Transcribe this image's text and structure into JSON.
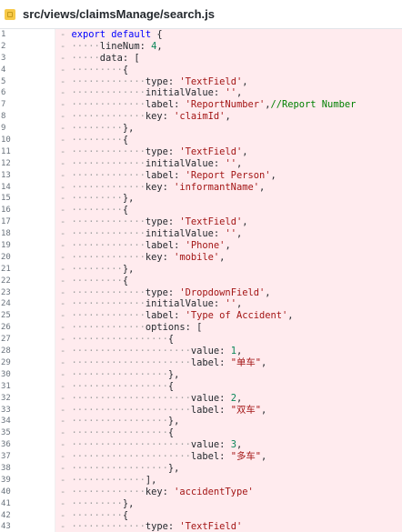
{
  "header": {
    "file_path": "src/views/claimsManage/search.js"
  },
  "code": {
    "lines": [
      [
        [
          "ws",
          "- "
        ],
        [
          "kw",
          "export default"
        ],
        [
          "txt",
          " {"
        ]
      ],
      [
        [
          "ws",
          "- ·····"
        ],
        [
          "txt",
          "lineNum: "
        ],
        [
          "num",
          "4"
        ],
        [
          "txt",
          ","
        ]
      ],
      [
        [
          "ws",
          "- ·····"
        ],
        [
          "txt",
          "data: ["
        ]
      ],
      [
        [
          "ws",
          "- ·········"
        ],
        [
          "txt",
          "{"
        ]
      ],
      [
        [
          "ws",
          "- ·············"
        ],
        [
          "txt",
          "type: "
        ],
        [
          "str",
          "'TextField'"
        ],
        [
          "txt",
          ","
        ]
      ],
      [
        [
          "ws",
          "- ·············"
        ],
        [
          "txt",
          "initialValue: "
        ],
        [
          "str",
          "''"
        ],
        [
          "txt",
          ","
        ]
      ],
      [
        [
          "ws",
          "- ·············"
        ],
        [
          "txt",
          "label: "
        ],
        [
          "str",
          "'ReportNumber'"
        ],
        [
          "txt",
          ","
        ],
        [
          "cmt",
          "//Report Number"
        ]
      ],
      [
        [
          "ws",
          "- ·············"
        ],
        [
          "txt",
          "key: "
        ],
        [
          "str",
          "'claimId'"
        ],
        [
          "txt",
          ","
        ]
      ],
      [
        [
          "ws",
          "- ·········"
        ],
        [
          "txt",
          "},"
        ]
      ],
      [
        [
          "ws",
          "- ·········"
        ],
        [
          "txt",
          "{"
        ]
      ],
      [
        [
          "ws",
          "- ·············"
        ],
        [
          "txt",
          "type: "
        ],
        [
          "str",
          "'TextField'"
        ],
        [
          "txt",
          ","
        ]
      ],
      [
        [
          "ws",
          "- ·············"
        ],
        [
          "txt",
          "initialValue: "
        ],
        [
          "str",
          "''"
        ],
        [
          "txt",
          ","
        ]
      ],
      [
        [
          "ws",
          "- ·············"
        ],
        [
          "txt",
          "label: "
        ],
        [
          "str",
          "'Report Person'"
        ],
        [
          "txt",
          ","
        ]
      ],
      [
        [
          "ws",
          "- ·············"
        ],
        [
          "txt",
          "key: "
        ],
        [
          "str",
          "'informantName'"
        ],
        [
          "txt",
          ","
        ]
      ],
      [
        [
          "ws",
          "- ·········"
        ],
        [
          "txt",
          "},"
        ]
      ],
      [
        [
          "ws",
          "- ·········"
        ],
        [
          "txt",
          "{"
        ]
      ],
      [
        [
          "ws",
          "- ·············"
        ],
        [
          "txt",
          "type: "
        ],
        [
          "str",
          "'TextField'"
        ],
        [
          "txt",
          ","
        ]
      ],
      [
        [
          "ws",
          "- ·············"
        ],
        [
          "txt",
          "initialValue: "
        ],
        [
          "str",
          "''"
        ],
        [
          "txt",
          ","
        ]
      ],
      [
        [
          "ws",
          "- ·············"
        ],
        [
          "txt",
          "label: "
        ],
        [
          "str",
          "'Phone'"
        ],
        [
          "txt",
          ","
        ]
      ],
      [
        [
          "ws",
          "- ·············"
        ],
        [
          "txt",
          "key: "
        ],
        [
          "str",
          "'mobile'"
        ],
        [
          "txt",
          ","
        ]
      ],
      [
        [
          "ws",
          "- ·········"
        ],
        [
          "txt",
          "},"
        ]
      ],
      [
        [
          "ws",
          "- ·········"
        ],
        [
          "txt",
          "{"
        ]
      ],
      [
        [
          "ws",
          "- ·············"
        ],
        [
          "txt",
          "type: "
        ],
        [
          "str",
          "'DropdownField'"
        ],
        [
          "txt",
          ","
        ]
      ],
      [
        [
          "ws",
          "- ·············"
        ],
        [
          "txt",
          "initialValue: "
        ],
        [
          "str",
          "''"
        ],
        [
          "txt",
          ","
        ]
      ],
      [
        [
          "ws",
          "- ·············"
        ],
        [
          "txt",
          "label: "
        ],
        [
          "str",
          "'Type of Accident'"
        ],
        [
          "txt",
          ","
        ]
      ],
      [
        [
          "ws",
          "- ·············"
        ],
        [
          "txt",
          "options: ["
        ]
      ],
      [
        [
          "ws",
          "- ·················"
        ],
        [
          "txt",
          "{"
        ]
      ],
      [
        [
          "ws",
          "- ·····················"
        ],
        [
          "txt",
          "value: "
        ],
        [
          "num",
          "1"
        ],
        [
          "txt",
          ","
        ]
      ],
      [
        [
          "ws",
          "- ·····················"
        ],
        [
          "txt",
          "label: "
        ],
        [
          "str",
          "\"单车\""
        ],
        [
          "txt",
          ","
        ]
      ],
      [
        [
          "ws",
          "- ·················"
        ],
        [
          "txt",
          "},"
        ]
      ],
      [
        [
          "ws",
          "- ·················"
        ],
        [
          "txt",
          "{"
        ]
      ],
      [
        [
          "ws",
          "- ·····················"
        ],
        [
          "txt",
          "value: "
        ],
        [
          "num",
          "2"
        ],
        [
          "txt",
          ","
        ]
      ],
      [
        [
          "ws",
          "- ·····················"
        ],
        [
          "txt",
          "label: "
        ],
        [
          "str",
          "\"双车\""
        ],
        [
          "txt",
          ","
        ]
      ],
      [
        [
          "ws",
          "- ·················"
        ],
        [
          "txt",
          "},"
        ]
      ],
      [
        [
          "ws",
          "- ·················"
        ],
        [
          "txt",
          "{"
        ]
      ],
      [
        [
          "ws",
          "- ·····················"
        ],
        [
          "txt",
          "value: "
        ],
        [
          "num",
          "3"
        ],
        [
          "txt",
          ","
        ]
      ],
      [
        [
          "ws",
          "- ·····················"
        ],
        [
          "txt",
          "label: "
        ],
        [
          "str",
          "\"多车\""
        ],
        [
          "txt",
          ","
        ]
      ],
      [
        [
          "ws",
          "- ·················"
        ],
        [
          "txt",
          "},"
        ]
      ],
      [
        [
          "ws",
          "- ·············"
        ],
        [
          "txt",
          "],"
        ]
      ],
      [
        [
          "ws",
          "- ·············"
        ],
        [
          "txt",
          "key: "
        ],
        [
          "str",
          "'accidentType'"
        ]
      ],
      [
        [
          "ws",
          "- ·········"
        ],
        [
          "txt",
          "},"
        ]
      ],
      [
        [
          "ws",
          "- ·········"
        ],
        [
          "txt",
          "{"
        ]
      ],
      [
        [
          "ws",
          "- ·············"
        ],
        [
          "txt",
          "type: "
        ],
        [
          "str",
          "'TextField'"
        ]
      ]
    ]
  }
}
